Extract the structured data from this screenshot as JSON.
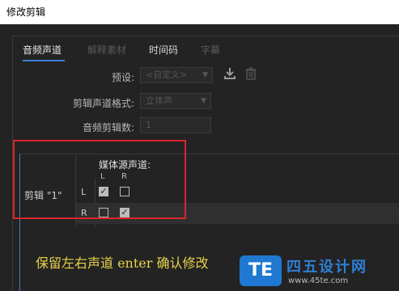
{
  "window": {
    "title": "修改剪辑"
  },
  "tabs": [
    {
      "label": "音频声道",
      "state": "active"
    },
    {
      "label": "解释素材",
      "state": "disabled"
    },
    {
      "label": "时间码",
      "state": "normal"
    },
    {
      "label": "字幕",
      "state": "disabled"
    }
  ],
  "preset": {
    "label": "预设:",
    "value": "<自定义>"
  },
  "format": {
    "label": "剪辑声道格式:",
    "value": "立体声"
  },
  "count": {
    "label": "音频剪辑数:",
    "value": "1"
  },
  "mapping": {
    "source_header": "媒体源声道:",
    "columns": [
      "L",
      "R"
    ],
    "clip_label": "剪辑 \"1\"",
    "rows": [
      {
        "channel": "L",
        "checks": [
          true,
          false
        ]
      },
      {
        "channel": "R",
        "checks": [
          false,
          true
        ]
      }
    ]
  },
  "caption": "保留左右声道  enter 确认修改",
  "watermark": {
    "badge": "TE",
    "name": "四五设计网",
    "url": "www.45te.com"
  },
  "colors": {
    "accent": "#3a7fd0",
    "highlight": "#d8262b",
    "caption": "#e8d24a"
  },
  "icons": {
    "preset_save": "download-icon",
    "preset_delete": "trash-icon"
  }
}
